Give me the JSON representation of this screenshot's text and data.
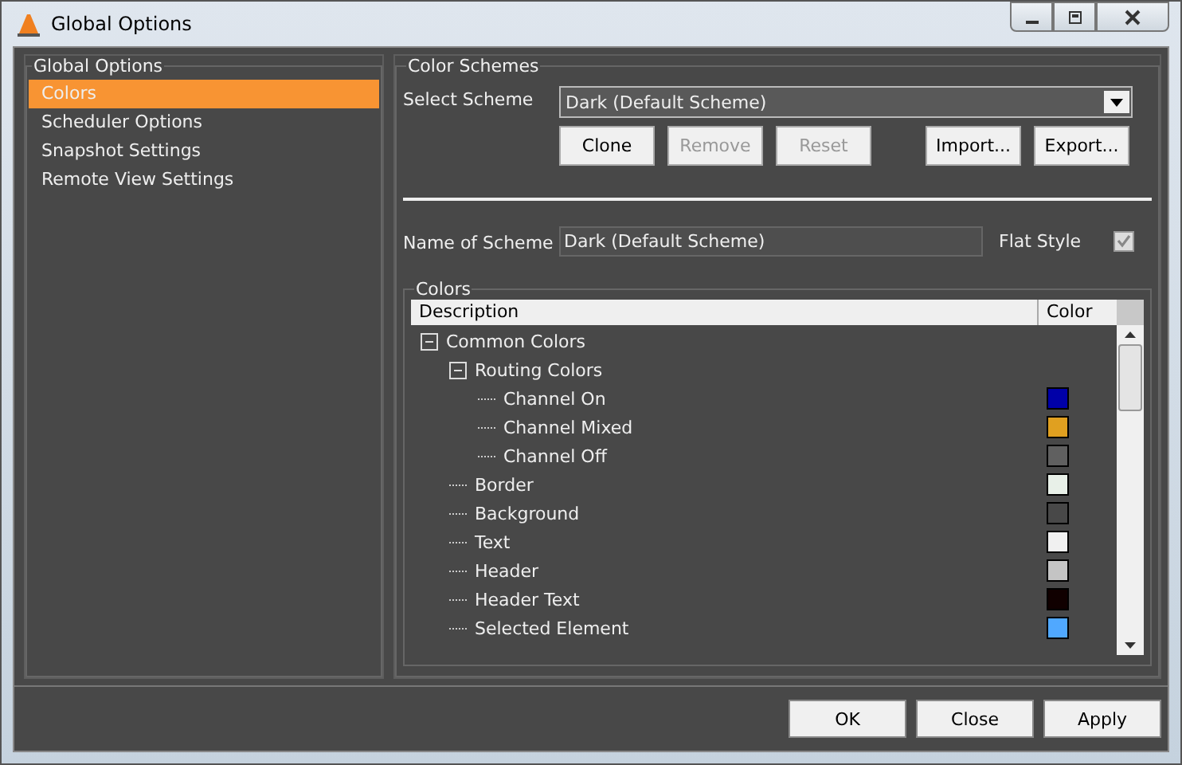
{
  "window": {
    "title": "Global Options"
  },
  "sidebar": {
    "title": "Global Options",
    "items": [
      {
        "label": "Colors",
        "selected": true
      },
      {
        "label": "Scheduler Options",
        "selected": false
      },
      {
        "label": "Snapshot Settings",
        "selected": false
      },
      {
        "label": "Remote View Settings",
        "selected": false
      }
    ]
  },
  "color_schemes": {
    "title": "Color Schemes",
    "select_label": "Select Scheme",
    "select_value": "Dark (Default Scheme)",
    "buttons": [
      {
        "label": "Clone",
        "disabled": false
      },
      {
        "label": "Remove",
        "disabled": true
      },
      {
        "label": "Reset",
        "disabled": true
      },
      {
        "label": "Import...",
        "disabled": false
      },
      {
        "label": "Export...",
        "disabled": false
      }
    ],
    "name_label": "Name of Scheme",
    "name_value": "Dark (Default Scheme)",
    "flat_style_label": "Flat Style",
    "flat_style_checked": true
  },
  "colors": {
    "title": "Colors",
    "columns": [
      "Description",
      "Color"
    ],
    "rows": [
      {
        "label": "Common Colors",
        "expanded": true,
        "children": [
          {
            "label": "Routing Colors",
            "expanded": true,
            "children": [
              {
                "label": "Channel On",
                "color": "#0000a8"
              },
              {
                "label": "Channel Mixed",
                "color": "#e0a020"
              },
              {
                "label": "Channel Off",
                "color": "#606060"
              }
            ]
          },
          {
            "label": "Border",
            "color": "#e8f0e8"
          },
          {
            "label": "Background",
            "color": "#484848"
          },
          {
            "label": "Text",
            "color": "#f0f0f0"
          },
          {
            "label": "Header",
            "color": "#c4c4c4"
          },
          {
            "label": "Header Text",
            "color": "#100000"
          },
          {
            "label": "Selected Element",
            "color": "#50a8ff"
          }
        ]
      }
    ]
  },
  "footer_buttons": [
    "OK",
    "Close",
    "Apply"
  ]
}
